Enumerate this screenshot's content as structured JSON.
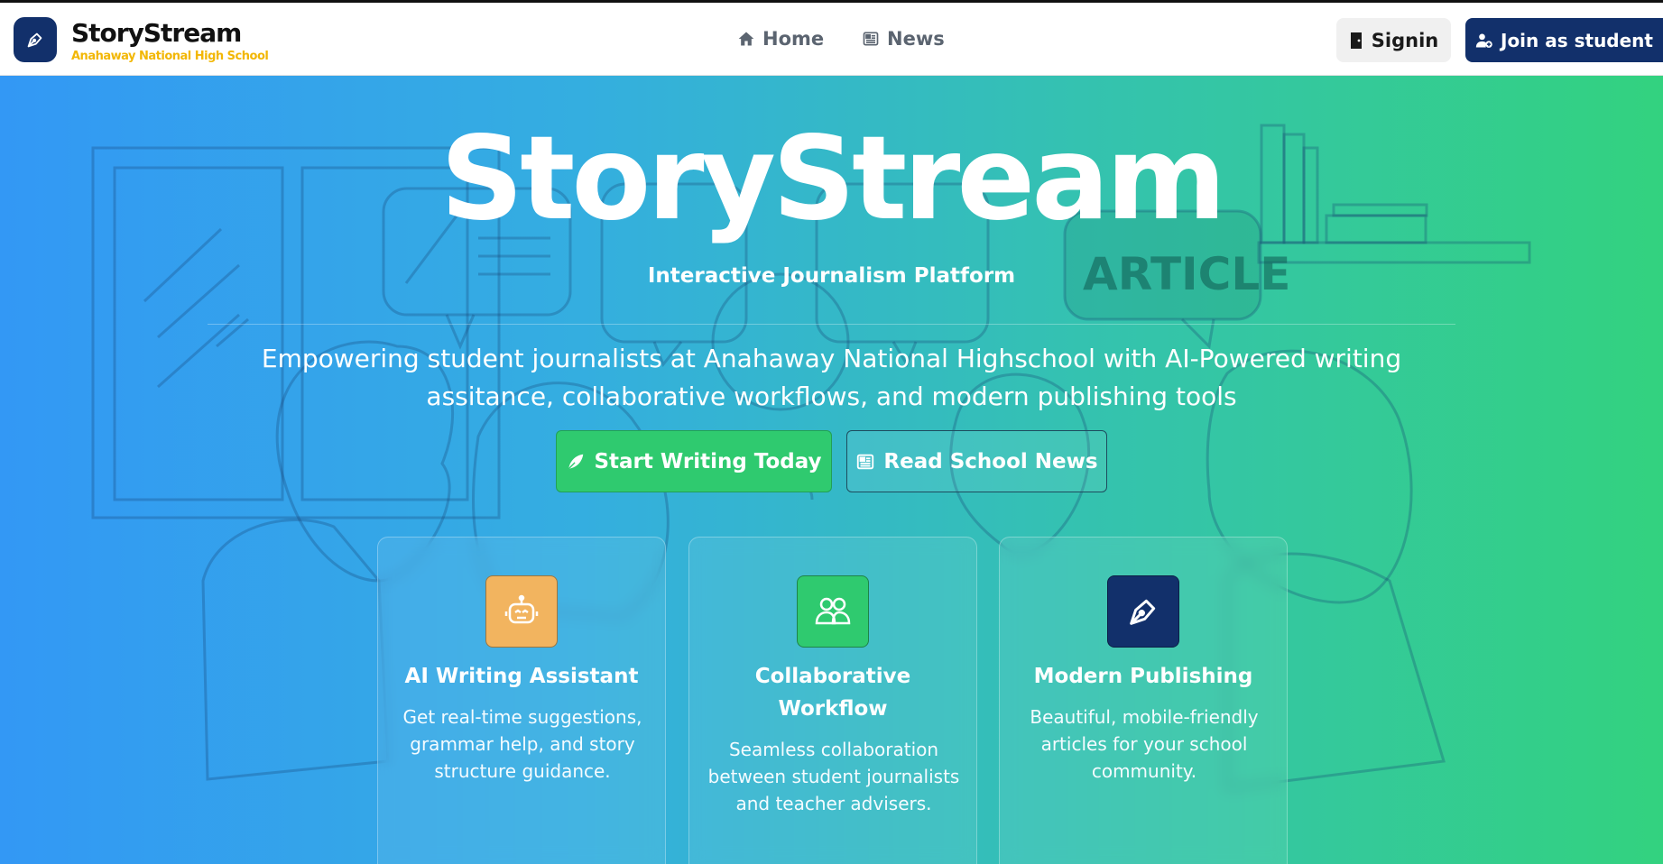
{
  "nav": {
    "brand_name": "StoryStream",
    "brand_subtitle": "Anahaway National High School",
    "links": [
      {
        "label": "Home",
        "icon": "home-icon"
      },
      {
        "label": "News",
        "icon": "newspaper-icon"
      }
    ],
    "signin_label": "Signin",
    "join_label": "Join as student"
  },
  "hero": {
    "title": "StoryStream",
    "tagline": "Interactive Journalism Platform",
    "description": "Empowering student journalists at Anahaway National Highschool with AI-Powered writing assitance, collaborative workflows, and modern publishing tools",
    "primary_cta": "Start Writing Today",
    "secondary_cta": "Read School News",
    "illustration_text": "ARTICLE"
  },
  "features": [
    {
      "title": "AI Writing Assistant",
      "text": "Get real-time suggestions, grammar help, and story structure guidance.",
      "icon": "robot-icon",
      "icon_bg": "#f2b45f"
    },
    {
      "title": "Collaborative Workflow",
      "text": "Seamless collaboration between student journalists and teacher advisers.",
      "icon": "users-icon",
      "icon_bg": "#2fca6f"
    },
    {
      "title": "Modern Publishing",
      "text": "Beautiful, mobile-friendly articles for your school community.",
      "icon": "pen-nib-icon",
      "icon_bg": "#12306b"
    }
  ],
  "colors": {
    "brand_navy": "#12306b",
    "brand_yellow": "#f2b705",
    "cta_green": "#2fca6f",
    "gradient_start": "#3398f5",
    "gradient_end": "#33d27f"
  }
}
